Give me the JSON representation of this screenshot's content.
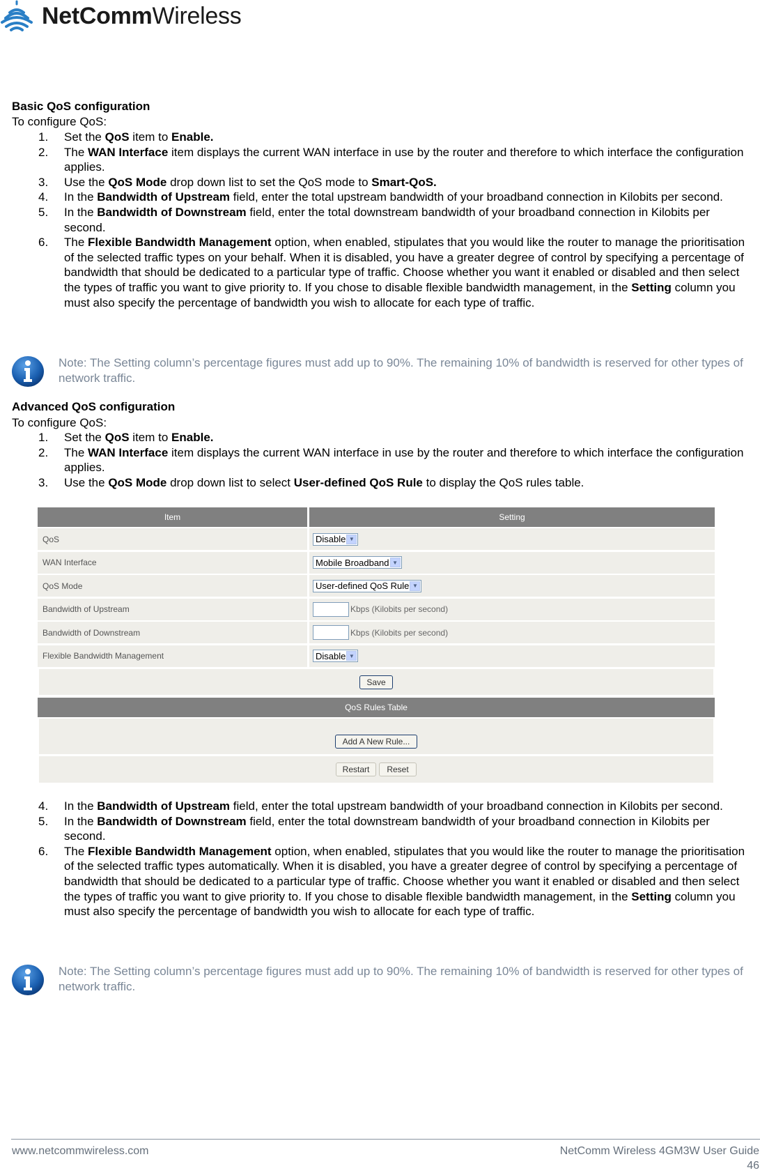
{
  "logo": {
    "brand_bold": "NetComm",
    "brand_light": "Wireless",
    "accent": "#2a7fc6"
  },
  "basic": {
    "heading": "Basic QoS configuration",
    "intro": "To configure QoS:",
    "steps": [
      {
        "num": "1.",
        "parts": [
          [
            "Set the ",
            false
          ],
          [
            "QoS",
            true
          ],
          [
            " item to ",
            false
          ],
          [
            "Enable.",
            true
          ]
        ]
      },
      {
        "num": "2.",
        "parts": [
          [
            "The ",
            false
          ],
          [
            "WAN Interface",
            true
          ],
          [
            " item displays the current WAN interface in use by the router and therefore to which interface the configuration applies.",
            false
          ]
        ]
      },
      {
        "num": "3.",
        "parts": [
          [
            "Use the ",
            false
          ],
          [
            "QoS Mode",
            true
          ],
          [
            " drop down list to set the QoS mode to ",
            false
          ],
          [
            "Smart-QoS.",
            true
          ]
        ]
      },
      {
        "num": "4.",
        "parts": [
          [
            "In the ",
            false
          ],
          [
            "Bandwidth of Upstream",
            true
          ],
          [
            " field, enter the total upstream bandwidth of your broadband connection in Kilobits per second.",
            false
          ]
        ]
      },
      {
        "num": "5.",
        "parts": [
          [
            "In the ",
            false
          ],
          [
            "Bandwidth of Downstream",
            true
          ],
          [
            " field, enter the total downstream bandwidth of your broadband connection in Kilobits per second.",
            false
          ]
        ]
      },
      {
        "num": "6.",
        "parts": [
          [
            "The ",
            false
          ],
          [
            "Flexible Bandwidth Management",
            true
          ],
          [
            " option, when enabled, stipulates that you would like the router to manage the prioritisation of the selected traffic types on your behalf. When it is disabled, you have a greater degree of control by specifying a percentage of bandwidth that should be dedicated to a particular type of traffic. Choose whether you want it enabled or disabled and then select the types of traffic you want to give priority to. If you chose to disable flexible bandwidth management, in the ",
            false
          ],
          [
            "Setting",
            true
          ],
          [
            " column you must also specify the percentage of bandwidth you wish to allocate for each type of traffic.",
            false
          ]
        ]
      }
    ],
    "note": "Note: The Setting column’s percentage figures must add up to 90%. The remaining 10% of bandwidth is reserved for other types of network traffic."
  },
  "advanced": {
    "heading": "Advanced QoS configuration",
    "intro": "To configure QoS:",
    "steps_a": [
      {
        "num": "1.",
        "parts": [
          [
            "Set the ",
            false
          ],
          [
            "QoS",
            true
          ],
          [
            " item to ",
            false
          ],
          [
            "Enable.",
            true
          ]
        ]
      },
      {
        "num": "2.",
        "parts": [
          [
            "The ",
            false
          ],
          [
            "WAN Interface",
            true
          ],
          [
            " item displays the current WAN interface in use by the router and therefore to which interface the configuration applies.",
            false
          ]
        ]
      },
      {
        "num": "3.",
        "parts": [
          [
            "Use the ",
            false
          ],
          [
            "QoS Mode",
            true
          ],
          [
            " drop down list to select ",
            false
          ],
          [
            "User-defined QoS Rule",
            true
          ],
          [
            " to display the QoS rules table.",
            false
          ]
        ]
      }
    ],
    "steps_b": [
      {
        "num": "4.",
        "parts": [
          [
            "In the ",
            false
          ],
          [
            "Bandwidth of Upstream",
            true
          ],
          [
            " field, enter the total upstream bandwidth of your broadband connection in Kilobits per second.",
            false
          ]
        ]
      },
      {
        "num": "5.",
        "parts": [
          [
            "In the ",
            false
          ],
          [
            "Bandwidth of Downstream",
            true
          ],
          [
            " field, enter the total downstream bandwidth of your broadband connection in Kilobits per second.",
            false
          ]
        ]
      },
      {
        "num": "6.",
        "parts": [
          [
            "The ",
            false
          ],
          [
            "Flexible Bandwidth Management",
            true
          ],
          [
            " option, when enabled, stipulates that you would like the router to manage the prioritisation of the selected traffic types automatically. When it is disabled, you have a greater degree of control by specifying a percentage of bandwidth that should be dedicated to a particular type of traffic. Choose whether you want it enabled or disabled and then select the types of traffic you want to give priority to. If you chose to disable flexible bandwidth management, in the ",
            false
          ],
          [
            "Setting",
            true
          ],
          [
            " column you must also specify the percentage of bandwidth you wish to allocate for each type of traffic.",
            false
          ]
        ]
      }
    ],
    "note": "Note: The Setting column’s percentage figures must add up to 90%. The remaining 10% of bandwidth is reserved for other types of network traffic."
  },
  "ui": {
    "header_item": "Item",
    "header_setting": "Setting",
    "rows": [
      {
        "label": "QoS",
        "type": "select",
        "value": "Disable"
      },
      {
        "label": "WAN Interface",
        "type": "select",
        "value": "Mobile Broadband"
      },
      {
        "label": "QoS Mode",
        "type": "select",
        "value": "User-defined QoS Rule"
      },
      {
        "label": "Bandwidth of Upstream",
        "type": "input",
        "value": "",
        "unit": "Kbps (Kilobits per second)"
      },
      {
        "label": "Bandwidth of Downstream",
        "type": "input",
        "value": "",
        "unit": "Kbps (Kilobits per second)"
      },
      {
        "label": "Flexible Bandwidth Management",
        "type": "select",
        "value": "Disable"
      }
    ],
    "save_label": "Save",
    "rules_table_title": "QoS Rules Table",
    "add_rule_label": "Add A New Rule...",
    "restart_label": "Restart",
    "reset_label": "Reset"
  },
  "footer": {
    "website": "www.netcommwireless.com",
    "guide_title": "NetComm Wireless 4GM3W User Guide",
    "page_number": "46"
  }
}
